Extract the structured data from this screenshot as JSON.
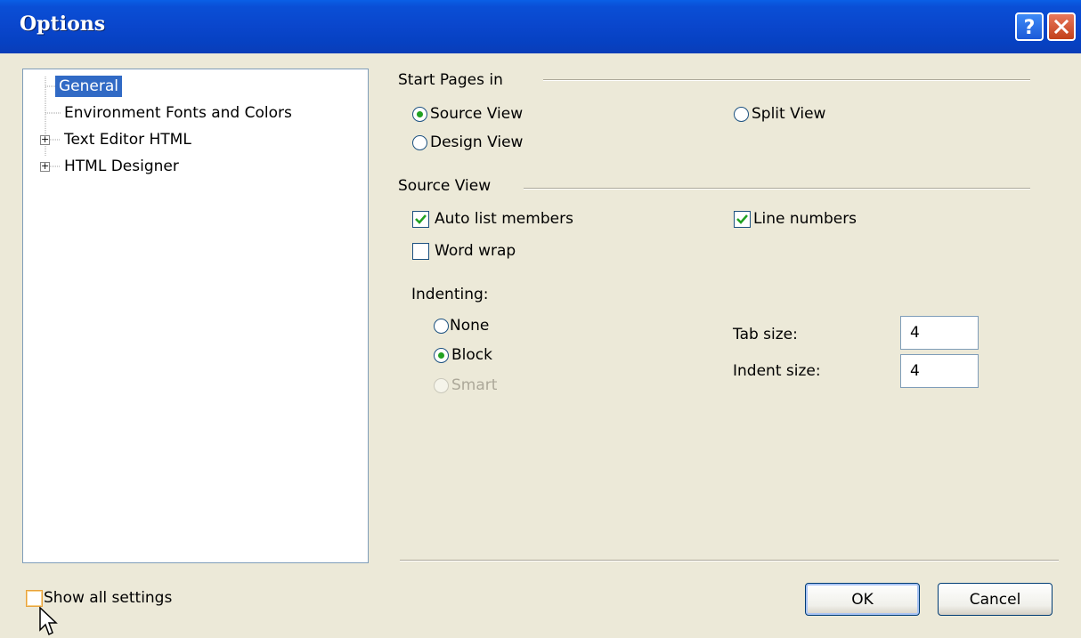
{
  "window": {
    "title": "Options"
  },
  "tree": {
    "items": [
      {
        "label": "General",
        "selected": true,
        "expandable": false
      },
      {
        "label": "Environment Fonts and Colors",
        "selected": false,
        "expandable": false
      },
      {
        "label": "Text Editor HTML",
        "selected": false,
        "expandable": true
      },
      {
        "label": "HTML Designer",
        "selected": false,
        "expandable": true
      }
    ]
  },
  "start_pages": {
    "header": "Start Pages in",
    "options": [
      {
        "label": "Source View",
        "checked": true
      },
      {
        "label": "Split View",
        "checked": false
      },
      {
        "label": "Design View",
        "checked": false
      }
    ]
  },
  "source_view": {
    "header": "Source View",
    "auto_list_members": {
      "label": "Auto list members",
      "checked": true
    },
    "line_numbers": {
      "label": "Line numbers",
      "checked": true
    },
    "word_wrap": {
      "label": "Word wrap",
      "checked": false
    }
  },
  "indenting": {
    "label": "Indenting:",
    "options": [
      {
        "label": "None",
        "checked": false,
        "disabled": false
      },
      {
        "label": "Block",
        "checked": true,
        "disabled": false
      },
      {
        "label": "Smart",
        "checked": false,
        "disabled": true
      }
    ]
  },
  "tab_size": {
    "label": "Tab size:",
    "value": "4"
  },
  "indent_size": {
    "label": "Indent size:",
    "value": "4"
  },
  "show_all": {
    "label": "Show all settings",
    "checked": false
  },
  "buttons": {
    "ok": "OK",
    "cancel": "Cancel"
  },
  "colors": {
    "title_bar": "#0a46cc",
    "selection": "#316ac5",
    "check": "#21a121",
    "dialog_bg": "#ece9d8"
  }
}
